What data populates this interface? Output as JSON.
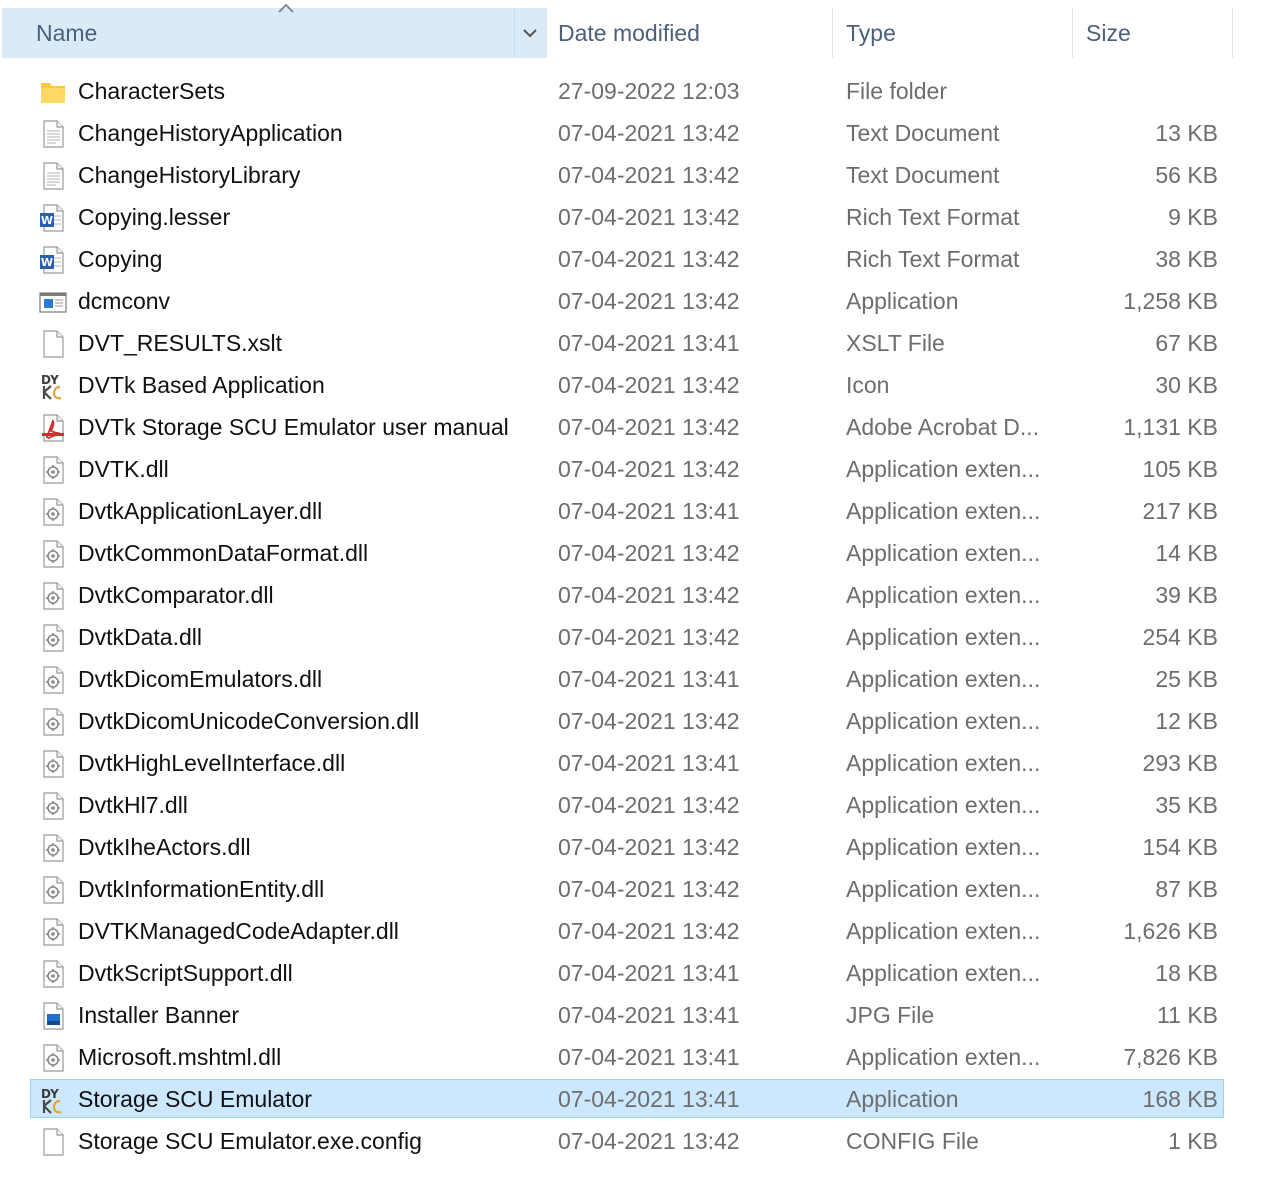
{
  "columns": {
    "name": "Name",
    "date": "Date modified",
    "type": "Type",
    "size": "Size"
  },
  "sort": {
    "column": "name",
    "direction": "ascending"
  },
  "selection_color": "#cce8ff",
  "files": [
    {
      "name": "CharacterSets",
      "date": "27-09-2022 12:03",
      "type": "File folder",
      "size": "",
      "icon": "folder-icon"
    },
    {
      "name": "ChangeHistoryApplication",
      "date": "07-04-2021 13:42",
      "type": "Text Document",
      "size": "13 KB",
      "icon": "text-document-icon"
    },
    {
      "name": "ChangeHistoryLibrary",
      "date": "07-04-2021 13:42",
      "type": "Text Document",
      "size": "56 KB",
      "icon": "text-document-icon"
    },
    {
      "name": "Copying.lesser",
      "date": "07-04-2021 13:42",
      "type": "Rich Text Format",
      "size": "9 KB",
      "icon": "word-document-icon"
    },
    {
      "name": "Copying",
      "date": "07-04-2021 13:42",
      "type": "Rich Text Format",
      "size": "38 KB",
      "icon": "word-document-icon"
    },
    {
      "name": "dcmconv",
      "date": "07-04-2021 13:42",
      "type": "Application",
      "size": "1,258 KB",
      "icon": "application-window-icon"
    },
    {
      "name": "DVT_RESULTS.xslt",
      "date": "07-04-2021 13:41",
      "type": "XSLT File",
      "size": "67 KB",
      "icon": "blank-file-icon"
    },
    {
      "name": "DVTk Based Application",
      "date": "07-04-2021 13:42",
      "type": "Icon",
      "size": "30 KB",
      "icon": "dvtk-logo-icon"
    },
    {
      "name": "DVTk Storage SCU Emulator user manual",
      "date": "07-04-2021 13:42",
      "type": "Adobe Acrobat D...",
      "size": "1,131 KB",
      "icon": "pdf-icon"
    },
    {
      "name": "DVTK.dll",
      "date": "07-04-2021 13:42",
      "type": "Application exten...",
      "size": "105 KB",
      "icon": "dll-gear-icon"
    },
    {
      "name": "DvtkApplicationLayer.dll",
      "date": "07-04-2021 13:41",
      "type": "Application exten...",
      "size": "217 KB",
      "icon": "dll-gear-icon"
    },
    {
      "name": "DvtkCommonDataFormat.dll",
      "date": "07-04-2021 13:42",
      "type": "Application exten...",
      "size": "14 KB",
      "icon": "dll-gear-icon"
    },
    {
      "name": "DvtkComparator.dll",
      "date": "07-04-2021 13:42",
      "type": "Application exten...",
      "size": "39 KB",
      "icon": "dll-gear-icon"
    },
    {
      "name": "DvtkData.dll",
      "date": "07-04-2021 13:42",
      "type": "Application exten...",
      "size": "254 KB",
      "icon": "dll-gear-icon"
    },
    {
      "name": "DvtkDicomEmulators.dll",
      "date": "07-04-2021 13:41",
      "type": "Application exten...",
      "size": "25 KB",
      "icon": "dll-gear-icon"
    },
    {
      "name": "DvtkDicomUnicodeConversion.dll",
      "date": "07-04-2021 13:42",
      "type": "Application exten...",
      "size": "12 KB",
      "icon": "dll-gear-icon"
    },
    {
      "name": "DvtkHighLevelInterface.dll",
      "date": "07-04-2021 13:41",
      "type": "Application exten...",
      "size": "293 KB",
      "icon": "dll-gear-icon"
    },
    {
      "name": "DvtkHl7.dll",
      "date": "07-04-2021 13:42",
      "type": "Application exten...",
      "size": "35 KB",
      "icon": "dll-gear-icon"
    },
    {
      "name": "DvtkIheActors.dll",
      "date": "07-04-2021 13:42",
      "type": "Application exten...",
      "size": "154 KB",
      "icon": "dll-gear-icon"
    },
    {
      "name": "DvtkInformationEntity.dll",
      "date": "07-04-2021 13:42",
      "type": "Application exten...",
      "size": "87 KB",
      "icon": "dll-gear-icon"
    },
    {
      "name": "DVTKManagedCodeAdapter.dll",
      "date": "07-04-2021 13:42",
      "type": "Application exten...",
      "size": "1,626 KB",
      "icon": "dll-gear-icon"
    },
    {
      "name": "DvtkScriptSupport.dll",
      "date": "07-04-2021 13:41",
      "type": "Application exten...",
      "size": "18 KB",
      "icon": "dll-gear-icon"
    },
    {
      "name": "Installer Banner",
      "date": "07-04-2021 13:41",
      "type": "JPG File",
      "size": "11 KB",
      "icon": "image-file-icon"
    },
    {
      "name": "Microsoft.mshtml.dll",
      "date": "07-04-2021 13:41",
      "type": "Application exten...",
      "size": "7,826 KB",
      "icon": "dll-gear-icon"
    },
    {
      "name": "Storage SCU Emulator",
      "date": "07-04-2021 13:41",
      "type": "Application",
      "size": "168 KB",
      "icon": "dvtk-logo-icon",
      "selected": true
    },
    {
      "name": "Storage SCU Emulator.exe.config",
      "date": "07-04-2021 13:42",
      "type": "CONFIG File",
      "size": "1 KB",
      "icon": "blank-file-icon"
    }
  ]
}
